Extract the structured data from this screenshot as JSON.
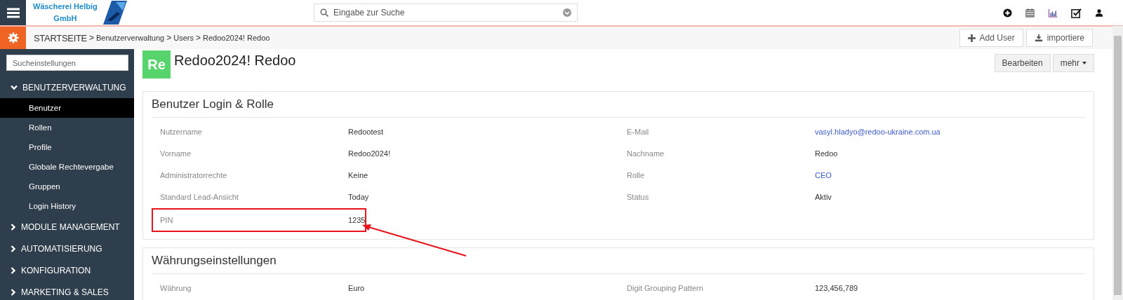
{
  "header": {
    "logo_lines": [
      "Wäscherei Helbig",
      "GmbH"
    ],
    "search": {
      "placeholder": "Eingabe zur Suche"
    },
    "icons": [
      {
        "kind": "plus"
      },
      {
        "kind": "calendar"
      },
      {
        "kind": "chart"
      },
      {
        "kind": "tasks"
      },
      {
        "kind": "user"
      }
    ]
  },
  "breadcrumb": {
    "home": "STARTSEITE",
    "separator": ">",
    "items": [
      "Benutzerverwaltung",
      "Users",
      "Redoo2024! Redoo"
    ]
  },
  "actions": [
    {
      "label": "Add User",
      "kind": "plus"
    },
    {
      "label": "importiere",
      "kind": "download"
    }
  ],
  "sidebar": {
    "search_placeholder": "Sucheinstellungen",
    "sections": [
      {
        "label": "BENUTZERVERWALTUNG",
        "expanded": true,
        "children": [
          {
            "label": "Benutzer",
            "selected": true
          },
          {
            "label": "Rollen",
            "selected": false
          },
          {
            "label": "Profile",
            "selected": false
          },
          {
            "label": "Globale Rechtevergabe",
            "selected": false
          },
          {
            "label": "Gruppen",
            "selected": false
          },
          {
            "label": "Login History",
            "selected": false
          }
        ]
      },
      {
        "label": "MODULE MANAGEMENT",
        "expanded": false
      },
      {
        "label": "AUTOMATISIERUNG",
        "expanded": false
      },
      {
        "label": "KONFIGURATION",
        "expanded": false
      },
      {
        "label": "MARKETING & SALES",
        "expanded": false
      }
    ]
  },
  "record": {
    "avatar": "Re",
    "title": "Redoo2024! Redoo",
    "buttons": [
      {
        "label": "Bearbeiten",
        "dropdown": false
      },
      {
        "label": "mehr",
        "dropdown": true
      }
    ]
  },
  "panels": [
    {
      "title": "Benutzer Login & Rolle",
      "fields": [
        {
          "label": "Nutzername",
          "value": "Redootest",
          "link": false,
          "highlighted": false
        },
        {
          "label": "E-Mail",
          "value": "vasyl.hladyo@redoo-ukraine.com.ua",
          "link": true,
          "highlighted": false
        },
        {
          "label": "Vorname",
          "value": "Redoo2024!",
          "link": false,
          "highlighted": false
        },
        {
          "label": "Nachname",
          "value": "Redoo",
          "link": false,
          "highlighted": false
        },
        {
          "label": "Administratorrechte",
          "value": "Keine",
          "link": false,
          "highlighted": false
        },
        {
          "label": "Rolle",
          "value": "CEO",
          "link": true,
          "highlighted": false
        },
        {
          "label": "Standard Lead-Ansicht",
          "value": "Today",
          "link": false,
          "highlighted": false
        },
        {
          "label": "Status",
          "value": "Aktiv",
          "link": false,
          "highlighted": false
        },
        {
          "label": "PIN",
          "value": "1235",
          "link": false,
          "highlighted": true
        }
      ]
    },
    {
      "title": "Währungseinstellungen",
      "fields": [
        {
          "label": "Währung",
          "value": "Euro",
          "link": false,
          "highlighted": false
        },
        {
          "label": "Digit Grouping Pattern",
          "value": "123,456,789",
          "link": false,
          "highlighted": false
        }
      ]
    }
  ]
}
